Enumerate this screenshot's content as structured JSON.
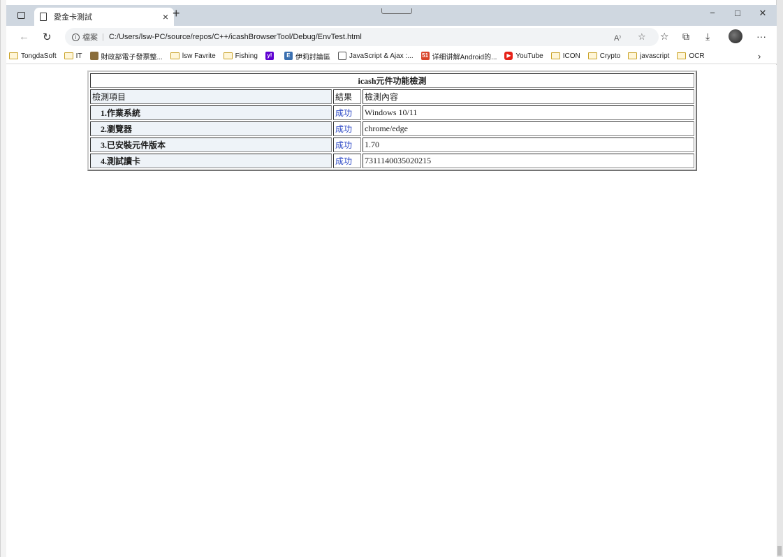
{
  "browser": {
    "tab_title": "愛金卡測試",
    "address_label": "檔案",
    "url": "C:/Users/lsw-PC/source/repos/C++/icashBrowserTool/Debug/EnvTest.html",
    "minimize": "−",
    "maximize": "□",
    "close": "✕"
  },
  "bookmarks": [
    {
      "label": "TongdaSoft",
      "icon": "folder-icon"
    },
    {
      "label": "IT",
      "icon": "folder-icon"
    },
    {
      "label": "財政部電子發票整...",
      "icon": "site-icon"
    },
    {
      "label": "lsw Favrite",
      "icon": "folder-icon"
    },
    {
      "label": "Fishing",
      "icon": "folder-icon"
    },
    {
      "label": "",
      "icon": "yahoo-icon"
    },
    {
      "label": "伊莉討論區",
      "icon": "eyny-icon"
    },
    {
      "label": "JavaScript & Ajax :...",
      "icon": "page-icon"
    },
    {
      "label": "详细讲解Android的...",
      "icon": "51-icon"
    },
    {
      "label": "YouTube",
      "icon": "youtube-icon"
    },
    {
      "label": "ICON",
      "icon": "folder-icon"
    },
    {
      "label": "Crypto",
      "icon": "folder-icon"
    },
    {
      "label": "javascript",
      "icon": "folder-icon"
    },
    {
      "label": "OCR",
      "icon": "folder-icon"
    }
  ],
  "page": {
    "table_title": "icash元件功能檢測",
    "headers": [
      "檢測項目",
      "結果",
      "檢測內容"
    ],
    "rows": [
      {
        "item": "1.作業系統",
        "result": "成功",
        "detail": "Windows 10/11"
      },
      {
        "item": "2.瀏覽器",
        "result": "成功",
        "detail": "chrome/edge"
      },
      {
        "item": "3.已安裝元件版本",
        "result": "成功",
        "detail": "1.70"
      },
      {
        "item": "4.測試讀卡",
        "result": "成功",
        "detail": "7311140035020215"
      }
    ]
  },
  "colors": {
    "tabstrip": "#cfd7e0",
    "success_text": "#2a46c5",
    "header_cell_bg": "#eef3f8"
  }
}
